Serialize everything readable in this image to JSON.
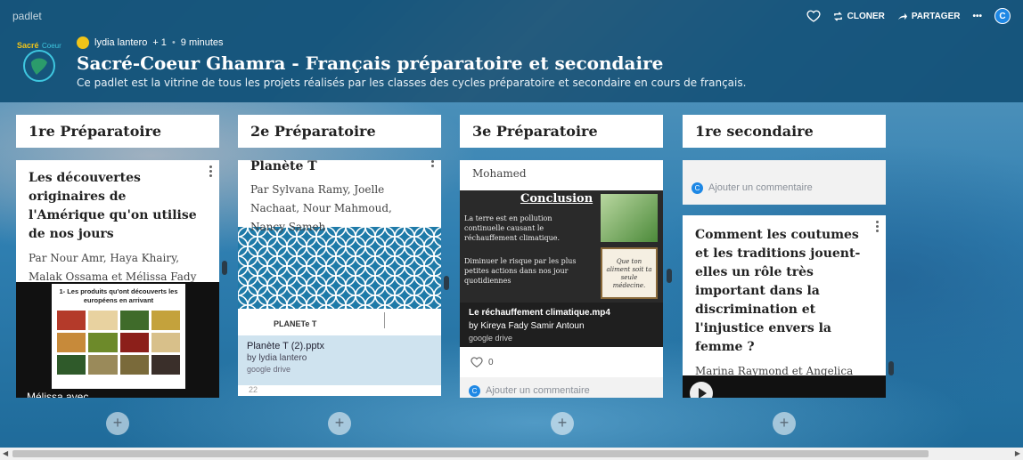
{
  "app": {
    "name": "padlet"
  },
  "header_actions": {
    "clone": "CLONER",
    "share": "PARTAGER",
    "more": "•••",
    "user_initial": "C"
  },
  "author": {
    "name": "lydia lantero",
    "plus": "+ 1",
    "sep": "•",
    "time": "9 minutes"
  },
  "logo": {
    "text": "Sacré-Coeur"
  },
  "board": {
    "title": "Sacré-Coeur Ghamra - Français préparatoire et secondaire",
    "description": "Ce padlet est la vitrine de tous les projets réalisés par les classes des cycles préparatoire et secondaire en cours de français."
  },
  "columns": [
    {
      "title": "1re Préparatoire"
    },
    {
      "title": "2e Préparatoire"
    },
    {
      "title": "3e Préparatoire"
    },
    {
      "title": "1re secondaire"
    }
  ],
  "col1": {
    "card_title": "Les découvertes originaires de l'Amérique qu'on utilise de nos jours",
    "authors": "Par Nour Amr, Haya Khairy, Malak Ossama et Mélissa Fady",
    "slide_title": "1- Les produits qu'ont découverts les européens en arrivant",
    "caption": "Mélissa avec"
  },
  "col2": {
    "card_title": "Planète T",
    "authors": "Par Sylvana Ramy, Joelle Nachaat, Nour Mahmoud, Nancy Sameh",
    "doc_label": "PLANETe T",
    "file_name": "Planète T (2).pptx",
    "file_by": "by lydia lantero",
    "file_source": "google drive",
    "comments": "22"
  },
  "col3": {
    "top_text": "Mohamed",
    "slide_heading": "Conclusion",
    "slide_text1": "La terre est en pollution continuelle causant le réchauffement climatique.",
    "slide_text2": "Diminuer le risque par les plus petites actions dans nos jour quotidiennes",
    "quote": "Que ton aliment soit ta seule médecine.",
    "video_name": "Le réchauffement climatique.mp4",
    "video_by": "by Kireya Fady Samir Antoun",
    "video_source": "google drive",
    "likes": "0",
    "comment_placeholder": "Ajouter un commentaire",
    "user_initial": "C"
  },
  "col4": {
    "comment_placeholder": "Ajouter un commentaire",
    "user_initial": "C",
    "card_title": "Comment les coutumes et les traditions jouent-elles un rôle très important dans la discrimination et l'injustice envers la femme ?",
    "authors": "Marina Raymond et Angelica Sameh"
  },
  "add_button": "+",
  "colors": {
    "header": "#165278",
    "accent": "#1e88e5",
    "doc_bg": "#cfe3ef"
  }
}
